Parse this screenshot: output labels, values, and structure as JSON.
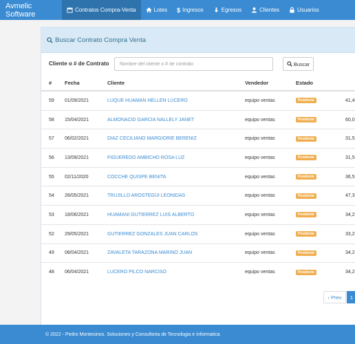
{
  "navbar": {
    "brand": "Avmelic Software",
    "items": [
      {
        "label": "Contratos Compra-Venta",
        "icon": "calendar-icon",
        "active": true
      },
      {
        "label": "Lotes",
        "icon": "home-icon"
      },
      {
        "label": "Ingresos",
        "icon": "dollar-icon"
      },
      {
        "label": "Egresos",
        "icon": "arrow-down-icon"
      },
      {
        "label": "Clientes",
        "icon": "user-icon"
      },
      {
        "label": "Usuarios",
        "icon": "lock-icon"
      }
    ]
  },
  "panel": {
    "title": "Buscar Contrato Compra Venta",
    "search_label": "Cliente o # de Contrato",
    "search_placeholder": "Nombre del cliente o # de contrato",
    "search_value": "",
    "search_button": "Buscar"
  },
  "table": {
    "headers": [
      "#",
      "Fecha",
      "Cliente",
      "Vendedor",
      "Estado",
      ""
    ],
    "rows": [
      {
        "num": "59",
        "date": "01/09/2021",
        "client": "LUQUE HUAMAN HELLEN LUCERO",
        "seller": "equipo ventas",
        "state": "Pendiente",
        "amount": "41,4"
      },
      {
        "num": "58",
        "date": "15/04/2021",
        "client": "ALMONACID GARCIA NALLELY JANET",
        "seller": "equipo ventas",
        "state": "Pendiente",
        "amount": "60,0"
      },
      {
        "num": "57",
        "date": "06/02/2021",
        "client": "DIAZ CECILIANO MARGIORIE BERENIZ",
        "seller": "equipo ventas",
        "state": "Pendiente",
        "amount": "31,5"
      },
      {
        "num": "56",
        "date": "13/09/2021",
        "client": "FIGUEREDO AMBICHO ROSA LUZ",
        "seller": "equipo ventas",
        "state": "Pendiente",
        "amount": "31,5"
      },
      {
        "num": "55",
        "date": "02/11/2020",
        "client": "COCCHE QUISPE BENITA",
        "seller": "equipo ventas",
        "state": "Pendiente",
        "amount": "36,5"
      },
      {
        "num": "54",
        "date": "28/05/2021",
        "client": "TRUJILLO AROSTEGUI LEONIDAS",
        "seller": "equipo ventas",
        "state": "Pendiente",
        "amount": "47,3"
      },
      {
        "num": "53",
        "date": "18/06/2021",
        "client": "HUAMANI GUTIERREZ LUIS ALBERTO",
        "seller": "equipo ventas",
        "state": "Pendiente",
        "amount": "34,2"
      },
      {
        "num": "52",
        "date": "29/05/2021",
        "client": "GUTIERREZ GONZALES JUAN CARLOS",
        "seller": "equipo ventas",
        "state": "Pendiente",
        "amount": "33,2"
      },
      {
        "num": "49",
        "date": "08/04/2021",
        "client": "ZAVALETA TARAZONA MARINO JUAN",
        "seller": "equipo ventas",
        "state": "Pendiente",
        "amount": "34,2"
      },
      {
        "num": "48",
        "date": "06/04/2021",
        "client": "LUCERO PILCO NARCISO",
        "seller": "equipo ventas",
        "state": "Pendiente",
        "amount": "34,2"
      }
    ]
  },
  "pagination": {
    "prev": "‹ Prev",
    "current": "1"
  },
  "footer": {
    "text": "© 2022 - Pedro Montesinos. Soluciones y Consultoria de Tecnologia e Informatica"
  },
  "colors": {
    "primary": "#3a8bd2",
    "active_nav": "#2f73ad",
    "badge": "#f0ad4e",
    "panel_heading": "#d9eaf6"
  }
}
